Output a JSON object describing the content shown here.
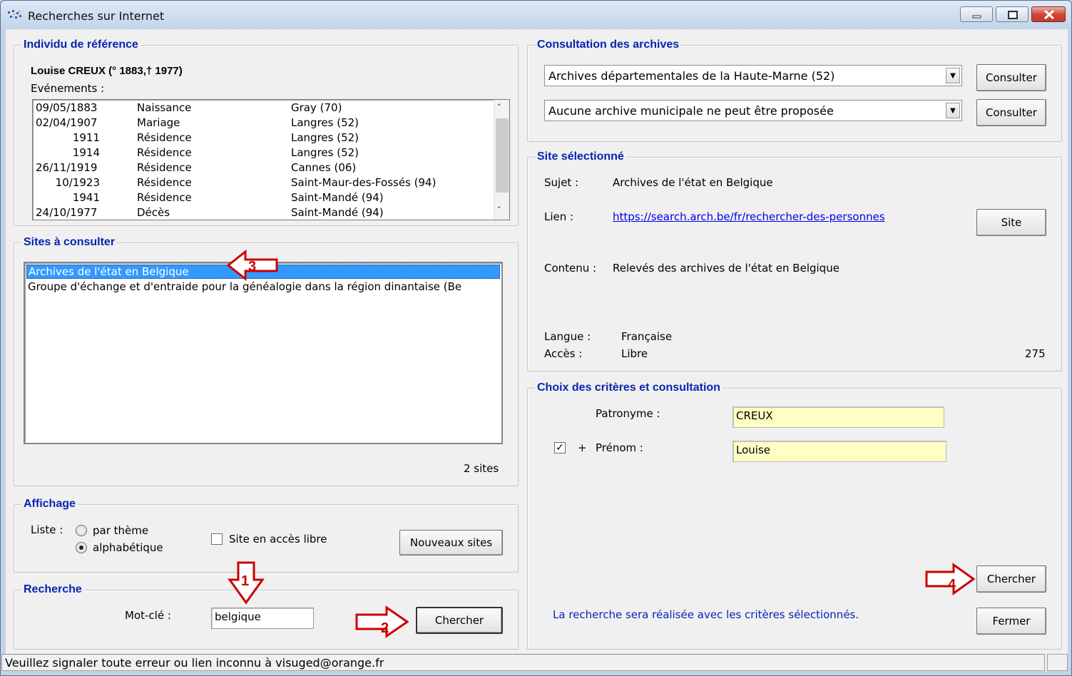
{
  "window": {
    "title": "Recherches sur Internet"
  },
  "reference": {
    "legend": "Individu de référence",
    "person": "Louise CREUX  (° 1883,† 1977)",
    "events_label": "Evénements :",
    "events": [
      {
        "date": "09/05/1883",
        "type": "Naissance",
        "place": "Gray (70)"
      },
      {
        "date": "02/04/1907",
        "type": "Mariage",
        "place": "Langres (52)"
      },
      {
        "date": "1911",
        "type": "Résidence",
        "place": "Langres (52)"
      },
      {
        "date": "1914",
        "type": "Résidence",
        "place": "Langres (52)"
      },
      {
        "date": "26/11/1919",
        "type": "Résidence",
        "place": "Cannes (06)"
      },
      {
        "date": "10/1923",
        "type": "Résidence",
        "place": "Saint-Maur-des-Fossés (94)"
      },
      {
        "date": "1941",
        "type": "Résidence",
        "place": "Saint-Mandé (94)"
      },
      {
        "date": "24/10/1977",
        "type": "Décès",
        "place": "Saint-Mandé (94)"
      }
    ]
  },
  "sites": {
    "legend": "Sites à consulter",
    "items": [
      "Archives de l'état en Belgique",
      "Groupe d'échange et d'entraide pour la généalogie dans la région dinantaise (Be"
    ],
    "count": "2 sites"
  },
  "display": {
    "legend": "Affichage",
    "list_label": "Liste :",
    "option_theme": "par thème",
    "option_alpha": "alphabétique",
    "free_access_label": "Site en accès libre",
    "new_sites_button": "Nouveaux sites"
  },
  "search": {
    "legend": "Recherche",
    "keyword_label": "Mot-clé :",
    "keyword_value": "belgique",
    "search_button": "Chercher"
  },
  "archives": {
    "legend": "Consultation des archives",
    "dept_value": "Archives départementales de la Haute-Marne (52)",
    "muni_value": "Aucune archive municipale ne peut être proposée",
    "consult_button": "Consulter"
  },
  "selected_site": {
    "legend": "Site sélectionné",
    "subject_label": "Sujet :",
    "subject_value": "Archives de l'état en Belgique",
    "link_label": "Lien :",
    "link_value": "https://search.arch.be/fr/rechercher-des-personnes",
    "site_button": "Site",
    "content_label": "Contenu :",
    "content_value": "Relevés des archives de l'état en Belgique",
    "language_label": "Langue :",
    "language_value": "Française",
    "access_label": "Accès :",
    "access_value": "Libre",
    "site_number": "275"
  },
  "criteria": {
    "legend": "Choix des critères et consultation",
    "surname_label": "Patronyme :",
    "surname_value": "CREUX",
    "plus": "+",
    "firstname_label": "Prénom :",
    "firstname_value": "Louise",
    "search_button": "Chercher",
    "info_text": "La recherche sera réalisée avec les critères sélectionnés.",
    "close_button": "Fermer"
  },
  "status_bar": {
    "text": "Veuillez signaler toute erreur ou lien inconnu à visuged@orange.fr"
  },
  "annotations": {
    "step1": "1",
    "step2": "2",
    "step3": "3",
    "step4": "4"
  },
  "colors": {
    "legend_blue": "#0a24b0",
    "selection": "#3399ff",
    "link": "#0000ee",
    "annotation_red": "#cc0000",
    "input_yellow": "#ffffc4"
  }
}
